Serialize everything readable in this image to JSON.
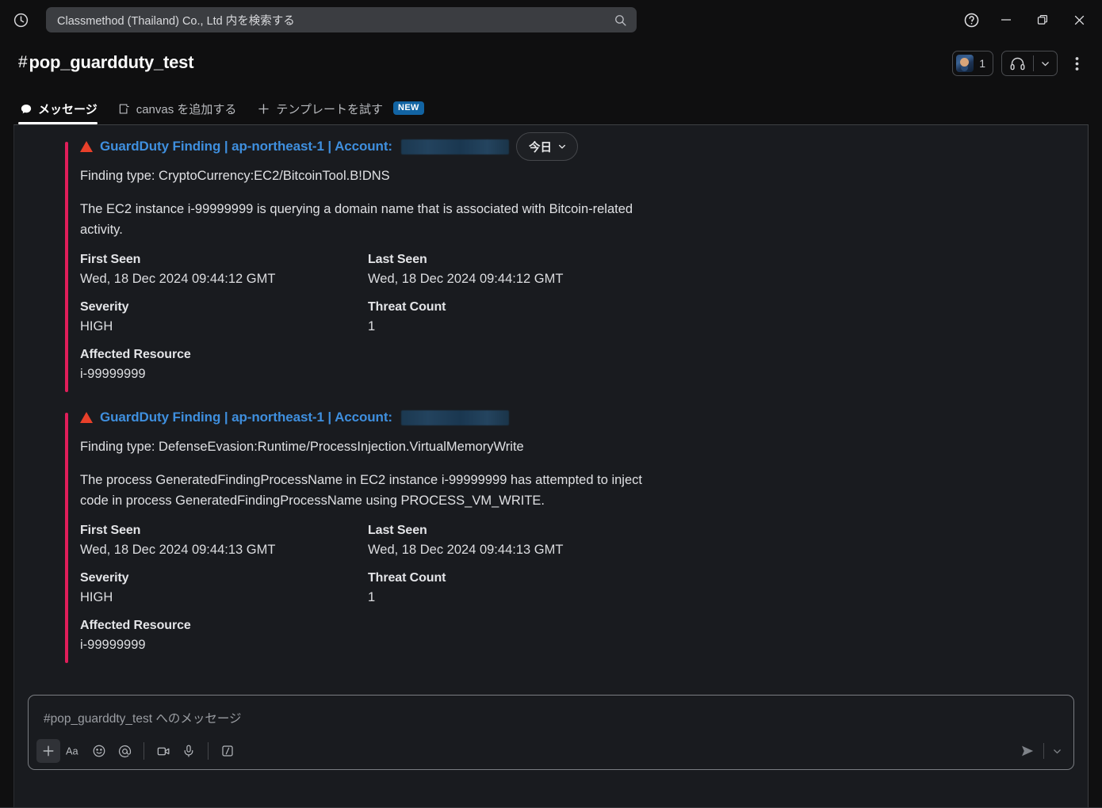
{
  "window": {
    "history_icon": "clock-icon",
    "help_icon": "help-circle-icon",
    "minimize_icon": "minimize-icon",
    "restore_icon": "restore-icon",
    "close_icon": "close-icon"
  },
  "search": {
    "value": "Classmethod (Thailand) Co., Ltd 内を検索する",
    "icon": "search-icon"
  },
  "channel": {
    "hash": "#",
    "name": "pop_guardduty_test",
    "member_count": "1",
    "huddle_icon": "headphones-icon",
    "chevron_icon": "chevron-down-icon",
    "more_icon": "kebab-menu-icon"
  },
  "tabs": [
    {
      "label": "メッセージ",
      "icon": "message-bubble-icon",
      "active": true,
      "badge": ""
    },
    {
      "label": "canvas を追加する",
      "icon": "canvas-icon",
      "active": false,
      "badge": ""
    },
    {
      "label": "テンプレートを試す",
      "icon": "plus-icon",
      "active": false,
      "badge": "NEW"
    }
  ],
  "date_divider": {
    "label": "今日",
    "chevron_icon": "chevron-down-icon"
  },
  "messages": [
    {
      "warning_icon": "warning-triangle-icon",
      "title": "GuardDuty Finding | ap-northeast-1 | Account:",
      "account_redacted": true,
      "finding_type_line": "Finding type: CryptoCurrency:EC2/BitcoinTool.B!DNS",
      "description": "The EC2 instance i-99999999 is querying a domain name that is associated with Bitcoin-related activity.",
      "fields": [
        {
          "label": "First Seen",
          "value": "Wed, 18 Dec 2024 09:44:12 GMT"
        },
        {
          "label": "Last Seen",
          "value": "Wed, 18 Dec 2024 09:44:12 GMT"
        },
        {
          "label": "Severity",
          "value": "HIGH"
        },
        {
          "label": "Threat Count",
          "value": "1"
        },
        {
          "label": "Affected Resource",
          "value": "i-99999999"
        }
      ]
    },
    {
      "warning_icon": "warning-triangle-icon",
      "title": "GuardDuty Finding | ap-northeast-1 | Account:",
      "account_redacted": true,
      "finding_type_line": "Finding type: DefenseEvasion:Runtime/ProcessInjection.VirtualMemoryWrite",
      "description": "The process GeneratedFindingProcessName in EC2 instance i-99999999 has attempted to inject code in process GeneratedFindingProcessName using PROCESS_VM_WRITE.",
      "fields": [
        {
          "label": "First Seen",
          "value": "Wed, 18 Dec 2024 09:44:13 GMT"
        },
        {
          "label": "Last Seen",
          "value": "Wed, 18 Dec 2024 09:44:13 GMT"
        },
        {
          "label": "Severity",
          "value": "HIGH"
        },
        {
          "label": "Threat Count",
          "value": "1"
        },
        {
          "label": "Affected Resource",
          "value": "i-99999999"
        }
      ]
    }
  ],
  "composer": {
    "placeholder": "#pop_guarddty_test へのメッセージ",
    "tools": [
      {
        "name": "plus-icon"
      },
      {
        "name": "text-format-icon"
      },
      {
        "name": "emoji-icon"
      },
      {
        "name": "mention-icon"
      },
      {
        "name": "video-icon"
      },
      {
        "name": "microphone-icon"
      },
      {
        "name": "slash-command-icon"
      }
    ],
    "send_icon": "send-icon",
    "send_options_icon": "chevron-down-icon"
  },
  "colors": {
    "accent_link": "#3f8fde",
    "warning": "#e8402a",
    "attachment_bar": "#e01e5a",
    "badge_new": "#1264a3",
    "app_bg": "#0f0f10",
    "pane_bg": "#191b1f"
  }
}
